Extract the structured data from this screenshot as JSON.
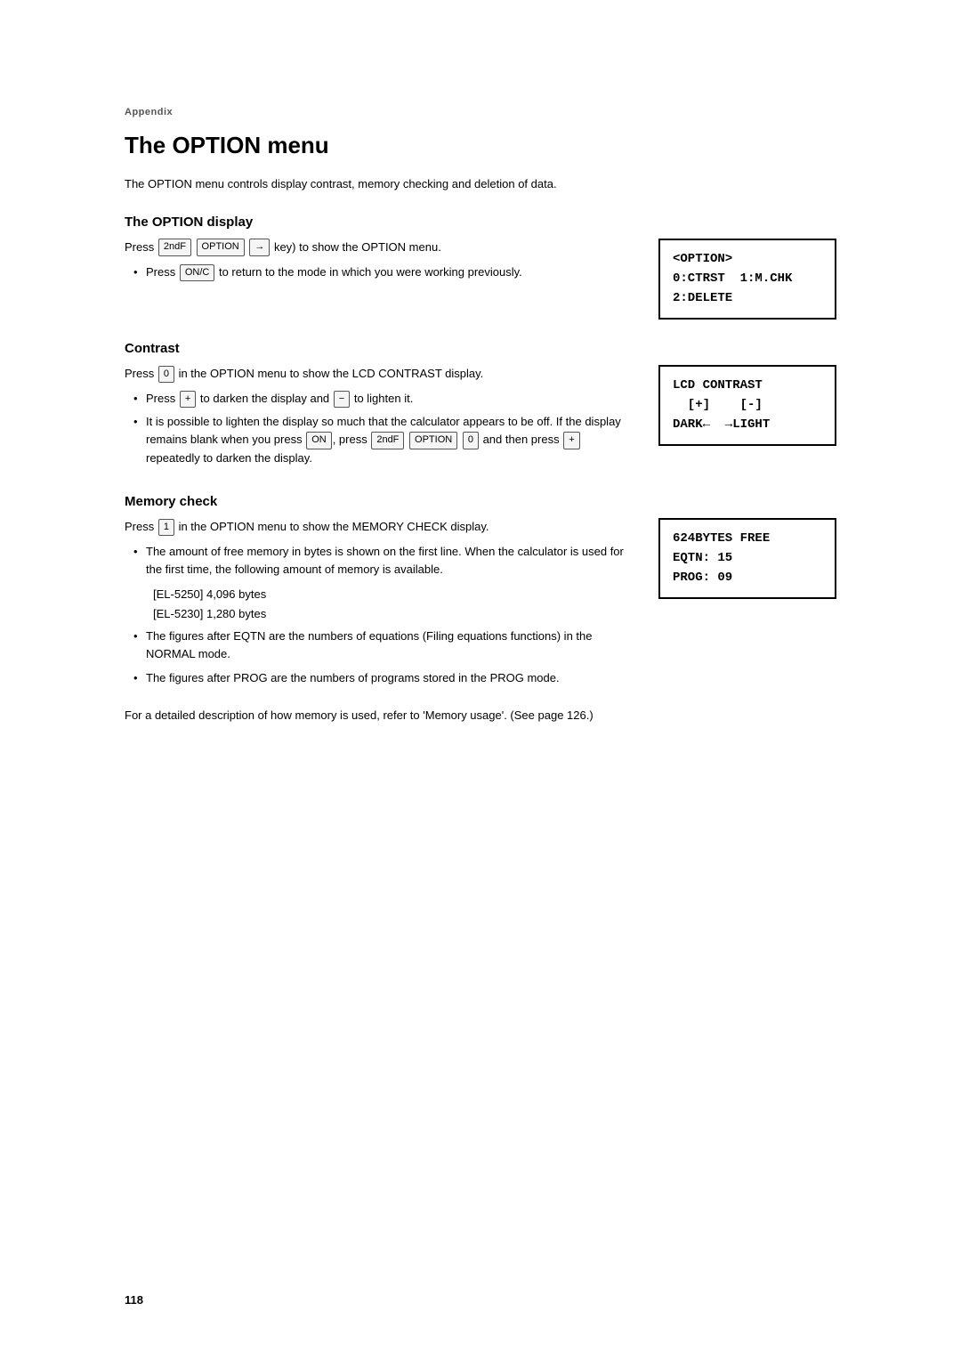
{
  "page": {
    "appendix_label": "Appendix",
    "title": "The OPTION menu",
    "intro": "The OPTION menu controls display contrast, memory checking and deletion of data.",
    "page_number": "118"
  },
  "section_option_display": {
    "title": "The OPTION display",
    "para1": "Press  2ndF   OPTION   (  →  key) to show the OPTION menu.",
    "bullet1": "Press  ON/C  to return to the mode in which you were working previously.",
    "lcd": "<OPTION>\n0:CTRST  1:M.CHK\n2:DELETE"
  },
  "section_contrast": {
    "title": "Contrast",
    "para1": "Press  0  in the OPTION menu to show the LCD CONTRAST display.",
    "bullet1": "Press  +  to darken the display and  −  to lighten it.",
    "bullet2": "It is possible to lighten the display so much that the calculator appears to be off. If the display remains blank when you press  ON , press  2ndF   OPTION   0  and then press  +  repeatedly to darken the display.",
    "lcd": "LCD CONTRAST\n  [+]    [-]\nDARK←  →LIGHT"
  },
  "section_memory": {
    "title": "Memory check",
    "para1": "Press  1  in the OPTION menu to show the MEMORY CHECK display.",
    "bullet1": "The amount of free memory in bytes is shown on the first line. When the calculator is used for the first time, the following amount of memory is available.",
    "model1": "[EL-5250]  4,096 bytes",
    "model2": "[EL-5230]  1,280 bytes",
    "bullet2": "The figures after EQTN are the numbers of equations (Filing equations functions) in the NORMAL mode.",
    "bullet3": "The figures after PROG are the numbers of programs stored in the PROG mode.",
    "footer": "For a detailed description of how memory is used, refer to 'Memory usage'. (See page 126.)",
    "lcd": "624BYTES FREE\nEQTN: 15\nPROG: 09"
  }
}
